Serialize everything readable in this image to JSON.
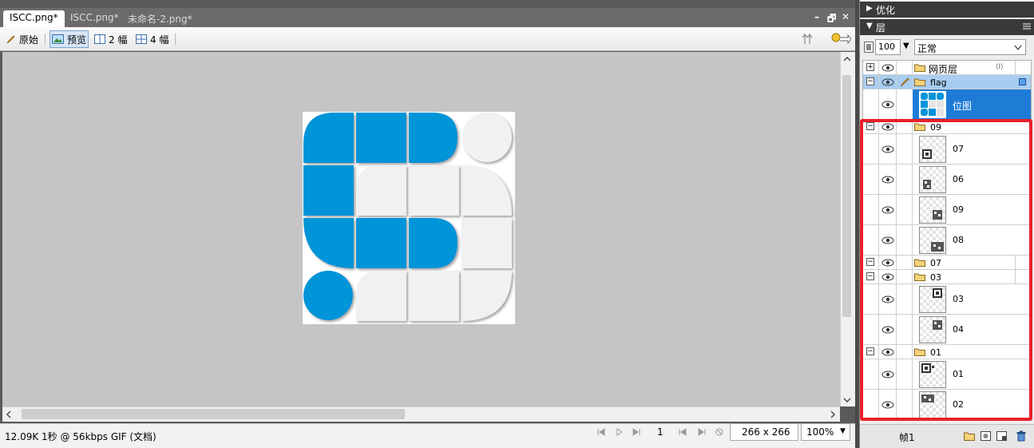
{
  "tabs": [
    "ISCC.png*",
    "ISCC.png*",
    "未命名-2.png*"
  ],
  "window_controls": {
    "minimize": "–",
    "restore": "🗗",
    "close": "✕"
  },
  "toolbar": {
    "original_label": "原始",
    "preview_label": "预览",
    "two_up_label": "2 幅",
    "four_up_label": "4 幅"
  },
  "status": {
    "file_info": "12.09K  1秒 @ 56kbps  GIF (文档)",
    "frame_number": "1",
    "dimensions": "266 x 266",
    "zoom": "100%"
  },
  "panel": {
    "optimize_title": "优化",
    "layers_title": "层",
    "opacity": "100",
    "blend_mode": "正常",
    "frame_label": "帧1",
    "layers": [
      {
        "name": "网页层",
        "type": "folder"
      },
      {
        "name": "flag",
        "type": "folder",
        "selected": true
      },
      {
        "name": "位图",
        "type": "bitmap",
        "selected": true
      },
      {
        "name": "09",
        "type": "folder"
      },
      {
        "name": "07",
        "type": "bitmap"
      },
      {
        "name": "06",
        "type": "bitmap"
      },
      {
        "name": "09",
        "type": "bitmap"
      },
      {
        "name": "08",
        "type": "bitmap"
      },
      {
        "name": "07",
        "type": "folder"
      },
      {
        "name": "03",
        "type": "folder"
      },
      {
        "name": "03",
        "type": "bitmap"
      },
      {
        "name": "04",
        "type": "bitmap"
      },
      {
        "name": "01",
        "type": "folder"
      },
      {
        "name": "01",
        "type": "bitmap"
      },
      {
        "name": "02",
        "type": "bitmap"
      }
    ]
  },
  "colors": {
    "accent_blue": "#0494d8",
    "highlight_red": "#e8202a",
    "selection": "#1e7cd6"
  }
}
